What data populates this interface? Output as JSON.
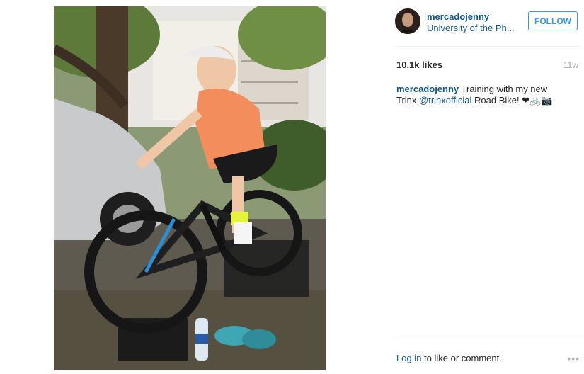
{
  "post": {
    "username": "mercadojenny",
    "location": "University of the Ph...",
    "follow_label": "FOLLOW",
    "likes": "10.1k likes",
    "age": "11w"
  },
  "caption": {
    "username": "mercadojenny",
    "text_before": " Training with my new Trinx ",
    "mention": "@trinxofficial",
    "text_after": " Road Bike! ❤🚲📷"
  },
  "comment": {
    "login_link": "Log in",
    "login_text": " to like or comment."
  },
  "more_label": "•••",
  "colors": {
    "link": "#125688",
    "follow": "#3897f0"
  }
}
